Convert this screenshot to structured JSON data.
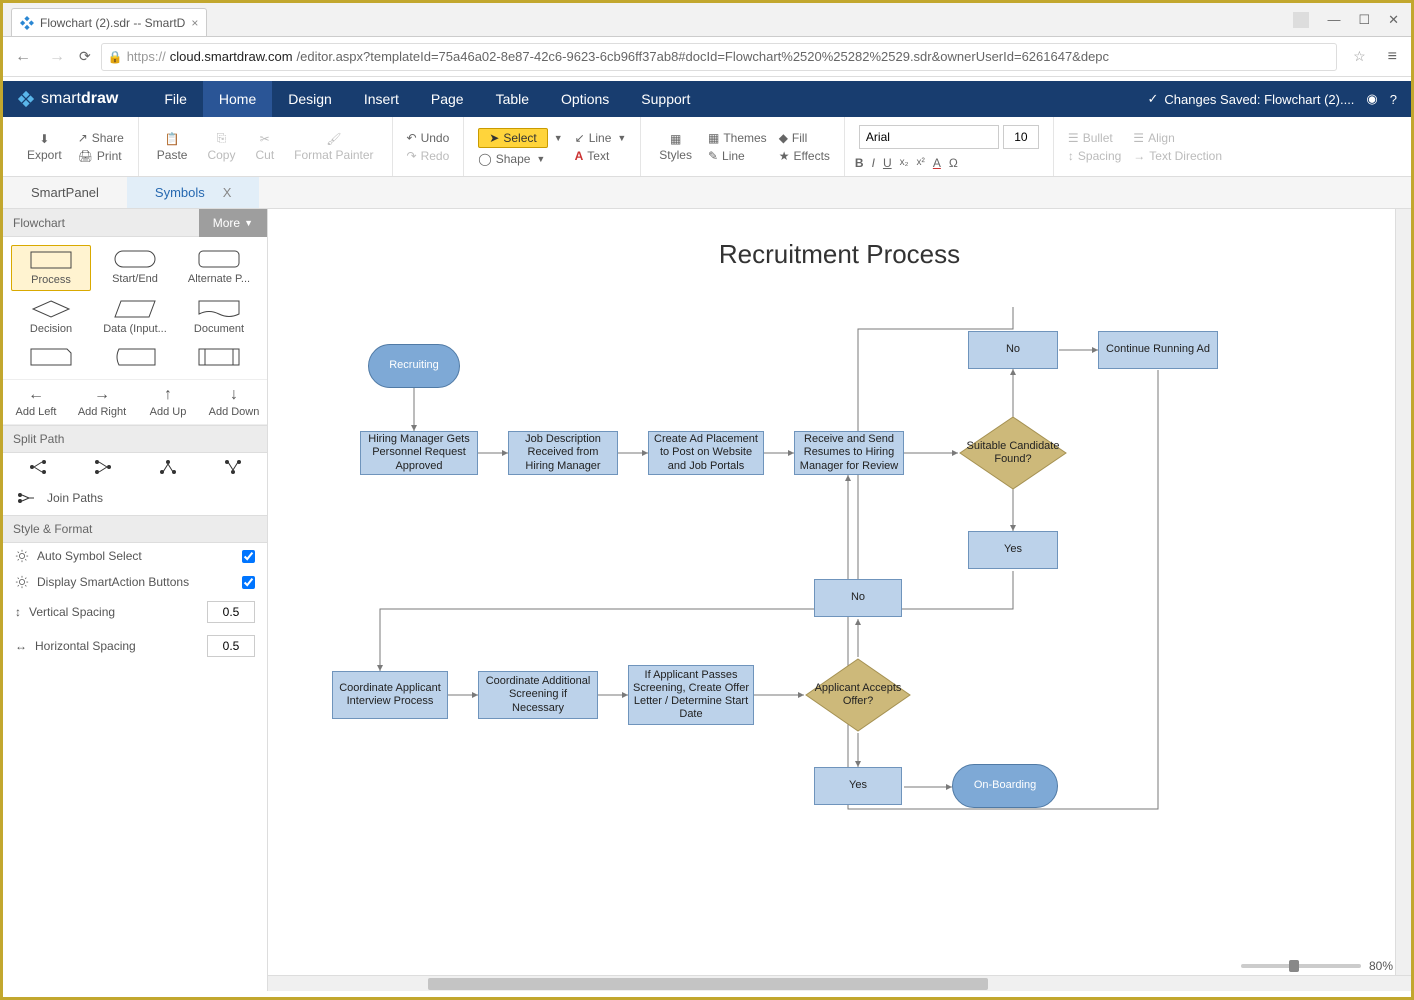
{
  "browser": {
    "tab_title": "Flowchart (2).sdr -- SmartD",
    "url_host": "cloud.smartdraw.com",
    "url_prefix": "https://",
    "url_path": "/editor.aspx?templateId=75a46a02-8e87-42c6-9623-6cb96ff37ab8#docId=Flowchart%2520%25282%2529.sdr&ownerUserId=6261647&depc"
  },
  "app": {
    "brand_prefix": "smart",
    "brand_suffix": "draw",
    "menu": [
      "File",
      "Home",
      "Design",
      "Insert",
      "Page",
      "Table",
      "Options",
      "Support"
    ],
    "active_menu": "Home",
    "save_status": "Changes Saved: Flowchart (2)...."
  },
  "ribbon": {
    "export": "Export",
    "share": "Share",
    "print": "Print",
    "paste": "Paste",
    "copy": "Copy",
    "cut": "Cut",
    "format_painter": "Format Painter",
    "undo": "Undo",
    "redo": "Redo",
    "select": "Select",
    "line": "Line",
    "shape": "Shape",
    "text": "Text",
    "styles": "Styles",
    "themes": "Themes",
    "fill": "Fill",
    "line2": "Line",
    "effects": "Effects",
    "font_name": "Arial",
    "font_size": "10",
    "bold": "B",
    "italic": "I",
    "underline": "U",
    "bullet": "Bullet",
    "align": "Align",
    "spacing": "Spacing",
    "text_direction": "Text Direction"
  },
  "panel_tabs": {
    "smartpanel": "SmartPanel",
    "symbols": "Symbols",
    "active": "Symbols"
  },
  "sidebar": {
    "header": "Flowchart",
    "more": "More",
    "shapes": [
      "Process",
      "Start/End",
      "Alternate P...",
      "Decision",
      "Data (Input...",
      "Document"
    ],
    "add": [
      "Add Left",
      "Add Right",
      "Add Up",
      "Add Down"
    ],
    "split_path": "Split Path",
    "join_paths": "Join Paths",
    "style_format": "Style & Format",
    "auto_symbol": "Auto Symbol Select",
    "display_smartaction": "Display SmartAction Buttons",
    "vspacing_label": "Vertical Spacing",
    "vspacing": "0.5",
    "hspacing_label": "Horizontal Spacing",
    "hspacing": "0.5"
  },
  "diagram": {
    "title": "Recruitment Process",
    "nodes": {
      "recruiting": "Recruiting",
      "n1": "Hiring Manager Gets Personnel Request Approved",
      "n2": "Job Description Received from Hiring Manager",
      "n3": "Create Ad Placement to Post on Website and Job Portals",
      "n4": "Receive and Send Resumes to Hiring Manager for Review",
      "d1": "Suitable Candidate Found?",
      "no1": "No",
      "yes1": "Yes",
      "continue": "Continue Running Ad",
      "n5": "Coordinate Applicant Interview Process",
      "n6": "Coordinate Additional Screening if Necessary",
      "n7": "If Applicant Passes Screening, Create Offer Letter / Determine Start Date",
      "d2": "Applicant Accepts Offer?",
      "no2": "No",
      "yes2": "Yes",
      "onboarding": "On-Boarding"
    }
  },
  "zoom": "80%"
}
